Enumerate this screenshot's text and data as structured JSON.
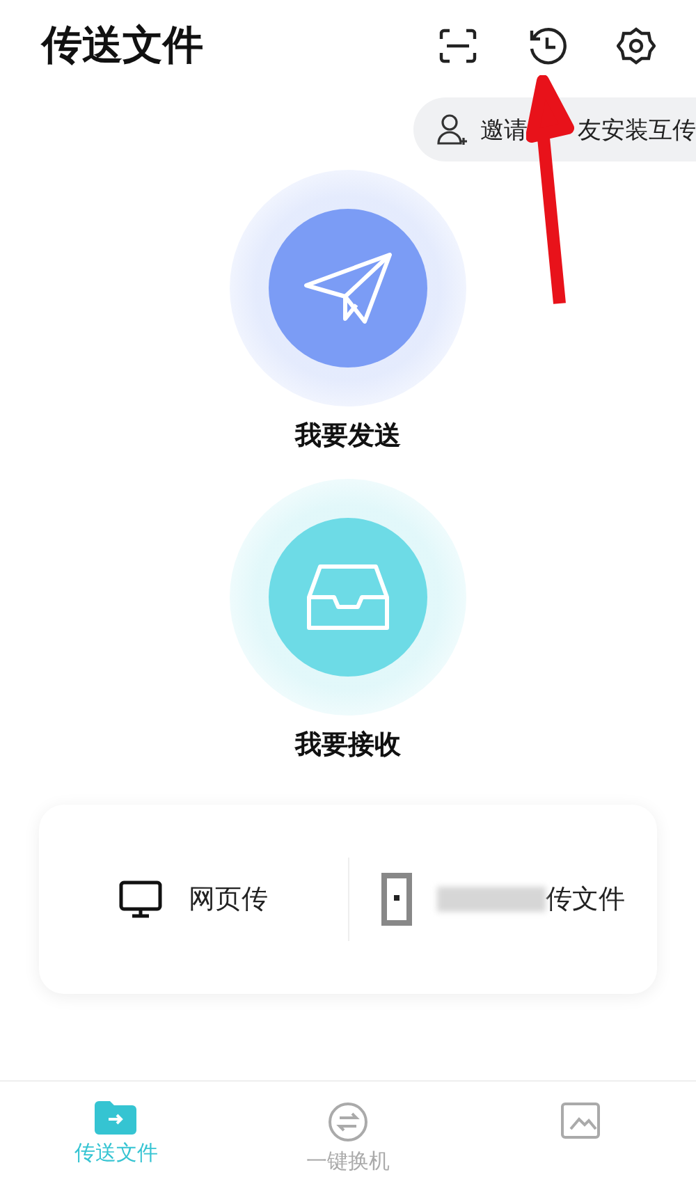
{
  "header": {
    "title": "传送文件"
  },
  "invite": {
    "parts": [
      "邀请",
      "友安装互传"
    ]
  },
  "actions": [
    {
      "kind": "send",
      "label": "我要发送"
    },
    {
      "kind": "receive",
      "label": "我要接收"
    }
  ],
  "options": [
    {
      "kind": "web",
      "label": "网页传"
    },
    {
      "kind": "phone",
      "label": "传文件"
    }
  ],
  "tabs": [
    {
      "kind": "transfer",
      "label": "传送文件",
      "selected": true
    },
    {
      "kind": "switch",
      "label": "一键换机",
      "selected": false
    },
    {
      "kind": "image",
      "selected": false
    }
  ]
}
